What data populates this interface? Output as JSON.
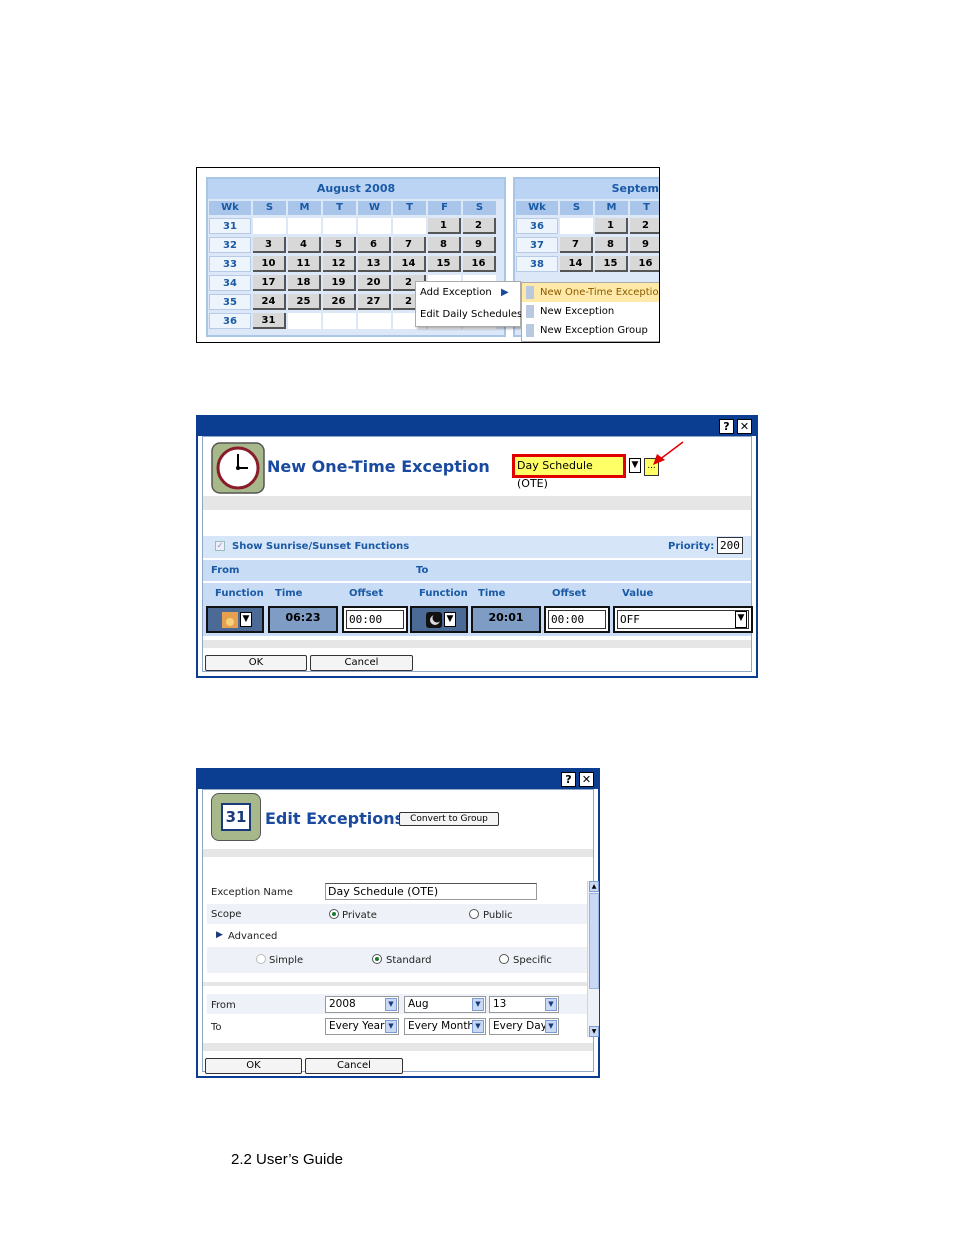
{
  "calendar": {
    "august": {
      "title": "August 2008",
      "headers": [
        "Wk",
        "S",
        "M",
        "T",
        "W",
        "T",
        "F",
        "S"
      ],
      "weeks": [
        "31",
        "32",
        "33",
        "34",
        "35",
        "36"
      ],
      "rows": [
        [
          "",
          "",
          "",
          "",
          "",
          "1",
          "2"
        ],
        [
          "3",
          "4",
          "5",
          "6",
          "7",
          "8",
          "9"
        ],
        [
          "10",
          "11",
          "12",
          "13",
          "14",
          "15",
          "16"
        ],
        [
          "17",
          "18",
          "19",
          "20",
          "2",
          "",
          ""
        ],
        [
          "24",
          "25",
          "26",
          "27",
          "2",
          "",
          ""
        ],
        [
          "31",
          "",
          "",
          "",
          "",
          "",
          ""
        ]
      ]
    },
    "september": {
      "title": "Septem",
      "headers": [
        "Wk",
        "S",
        "M",
        "T"
      ],
      "weeks": [
        "36",
        "37",
        "38"
      ],
      "rows": [
        [
          "",
          "1",
          "2"
        ],
        [
          "7",
          "8",
          "9"
        ],
        [
          "14",
          "15",
          "16"
        ]
      ]
    },
    "context_menu": {
      "items": [
        "Add Exception",
        "Edit Daily Schedules"
      ],
      "submenu": [
        "New One-Time Exception",
        "New Exception",
        "New Exception Group"
      ]
    }
  },
  "dialog_one_time": {
    "help": "?",
    "close": "✕",
    "title": "New One-Time Exception",
    "schedule_select": "Day Schedule (OTE)",
    "ellipsis": "...",
    "show_sunrise": "Show Sunrise/Sunset Functions",
    "priority_label": "Priority:",
    "priority_value": "200",
    "from_label": "From",
    "to_label": "To",
    "columns": [
      "Function",
      "Time",
      "Offset",
      "Function",
      "Time",
      "Offset",
      "Value"
    ],
    "from_time": "06:23",
    "from_offset": "00:00",
    "to_time": "20:01",
    "to_offset": "00:00",
    "value": "OFF",
    "ok": "OK",
    "cancel": "Cancel"
  },
  "dialog_edit": {
    "help": "?",
    "close": "✕",
    "icon_day": "31",
    "title": "Edit Exceptions",
    "convert": "Convert to Group",
    "exception_name_label": "Exception Name",
    "exception_name_value": "Day Schedule (OTE)",
    "scope_label": "Scope",
    "scope_private": "Private",
    "scope_public": "Public",
    "advanced_label": "Advanced",
    "mode_simple": "Simple",
    "mode_standard": "Standard",
    "mode_specific": "Specific",
    "from_label": "From",
    "from_year": "2008",
    "from_month": "Aug",
    "from_day": "13",
    "to_label": "To",
    "to_year": "Every Year",
    "to_month": "Every Month",
    "to_day": "Every Day",
    "ok": "OK",
    "cancel": "Cancel"
  },
  "footer": {
    "text": "2.2 User’s Guide"
  }
}
